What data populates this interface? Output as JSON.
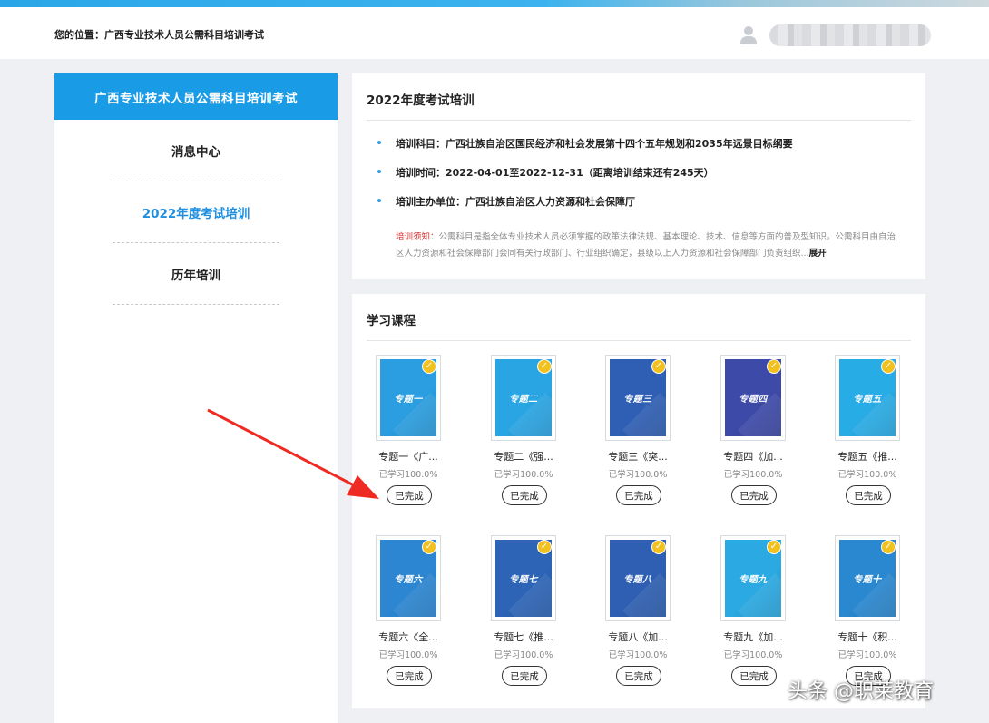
{
  "breadcrumb": {
    "label": "您的位置：",
    "current": "广西专业技术人员公需科目培训考试"
  },
  "sidebar": {
    "title": "广西专业技术人员公需科目培训考试",
    "items": [
      {
        "label": "消息中心",
        "active": false
      },
      {
        "label": "2022年度考试培训",
        "active": true
      },
      {
        "label": "历年培训",
        "active": false
      }
    ]
  },
  "exam": {
    "title": "2022年度考试培训",
    "subject": "培训科目：广西壮族自治区国民经济和社会发展第十四个五年规划和2035年远景目标纲要",
    "time": "培训时间：2022-04-01至2022-12-31（距离培训结束还有245天）",
    "organizer": "培训主办单位：广西壮族自治区人力资源和社会保障厅",
    "notice_label": "培训须知：",
    "notice_text": "公需科目是指全体专业技术人员必须掌握的政策法律法规、基本理论、技术、信息等方面的普及型知识。公需科目由自治区人力资源和社会保障部门会同有关行政部门、行业组织确定，县级以上人力资源和社会保障部门负责组织...",
    "notice_more": "展开"
  },
  "courses": {
    "title": "学习课程",
    "items": [
      {
        "cover": "专题一",
        "name": "专题一《广...",
        "progress": "已学习100.0%",
        "status": "已完成",
        "color": "#2a9ee0"
      },
      {
        "cover": "专题二",
        "name": "专题二《强...",
        "progress": "已学习100.0%",
        "status": "已完成",
        "color": "#2aa5e4"
      },
      {
        "cover": "专题三",
        "name": "专题三《突...",
        "progress": "已学习100.0%",
        "status": "已完成",
        "color": "#2f5fb4"
      },
      {
        "cover": "专题四",
        "name": "专题四《加...",
        "progress": "已学习100.0%",
        "status": "已完成",
        "color": "#3d4aa8"
      },
      {
        "cover": "专题五",
        "name": "专题五《推...",
        "progress": "已学习100.0%",
        "status": "已完成",
        "color": "#28ace6"
      },
      {
        "cover": "专题六",
        "name": "专题六《全...",
        "progress": "已学习100.0%",
        "status": "已完成",
        "color": "#2c86d2"
      },
      {
        "cover": "专题七",
        "name": "专题七《推...",
        "progress": "已学习100.0%",
        "status": "已完成",
        "color": "#2d64b6"
      },
      {
        "cover": "专题八",
        "name": "专题八《加...",
        "progress": "已学习100.0%",
        "status": "已完成",
        "color": "#2e5fb2"
      },
      {
        "cover": "专题九",
        "name": "专题九《加...",
        "progress": "已学习100.0%",
        "status": "已完成",
        "color": "#2aa9e2"
      },
      {
        "cover": "专题十",
        "name": "专题十《积...",
        "progress": "已学习100.0%",
        "status": "已完成",
        "color": "#2a88d0"
      }
    ]
  },
  "watermark": "头条 @职莱教育"
}
